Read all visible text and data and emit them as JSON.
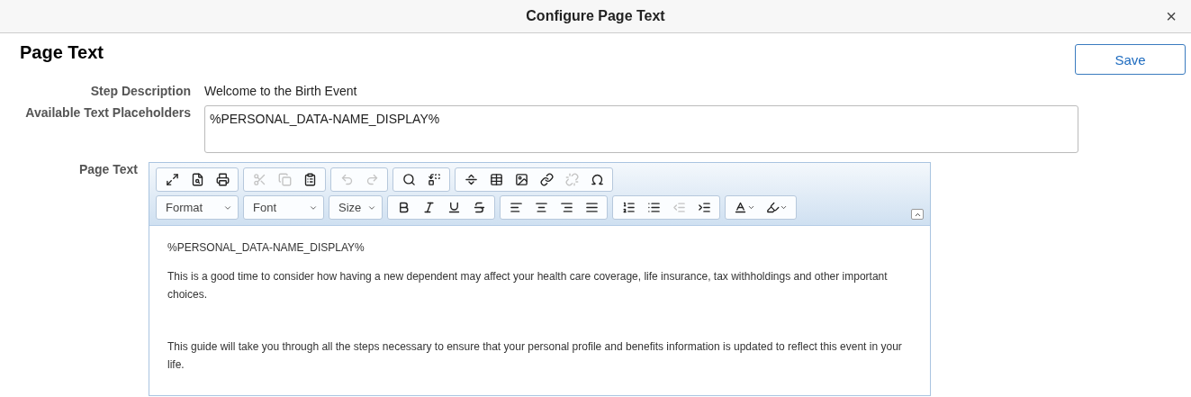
{
  "window": {
    "title": "Configure Page Text",
    "close": "×"
  },
  "page": {
    "heading": "Page Text",
    "save_button": "Save"
  },
  "fields": [
    {
      "kind": "text",
      "label": "Step Description",
      "value": "Welcome to the Birth Event"
    },
    {
      "kind": "textarea",
      "label": "Available Text Placeholders",
      "value": "%PERSONAL_DATA-NAME_DISPLAY%"
    }
  ],
  "editor": {
    "label": "Page Text",
    "toolbar_row_1": [
      [
        {
          "kind": "maximize",
          "disabled": false
        },
        {
          "kind": "preview",
          "disabled": false
        },
        {
          "kind": "print",
          "disabled": false
        }
      ],
      [
        {
          "kind": "cut",
          "disabled": true
        },
        {
          "kind": "copy",
          "disabled": true
        },
        {
          "kind": "paste",
          "disabled": false
        }
      ],
      [
        {
          "kind": "undo",
          "disabled": true
        },
        {
          "kind": "redo",
          "disabled": true
        }
      ],
      [
        {
          "kind": "find",
          "disabled": false
        },
        {
          "kind": "replace",
          "disabled": false
        }
      ],
      [
        {
          "kind": "rule",
          "disabled": false
        },
        {
          "kind": "table",
          "disabled": false
        },
        {
          "kind": "image",
          "disabled": false
        },
        {
          "kind": "link",
          "disabled": false
        },
        {
          "kind": "unlink",
          "disabled": true
        },
        {
          "kind": "symbol",
          "disabled": false
        }
      ]
    ],
    "dropdowns": [
      "Format",
      "Font",
      "Size"
    ],
    "toolbar_row_2": [
      [
        {
          "kind": "bold",
          "disabled": false
        },
        {
          "kind": "italic",
          "disabled": false
        },
        {
          "kind": "underline",
          "disabled": false
        },
        {
          "kind": "strike",
          "disabled": false
        }
      ],
      [
        {
          "kind": "align-left",
          "disabled": false
        },
        {
          "kind": "align-center",
          "disabled": false
        },
        {
          "kind": "align-right",
          "disabled": false
        },
        {
          "kind": "justify",
          "disabled": false
        }
      ],
      [
        {
          "kind": "numbered",
          "disabled": false
        },
        {
          "kind": "bulleted",
          "disabled": false
        },
        {
          "kind": "outdent",
          "disabled": true
        },
        {
          "kind": "indent",
          "disabled": false
        }
      ],
      [
        {
          "kind": "text-color",
          "disabled": false
        },
        {
          "kind": "bg-color",
          "disabled": false
        }
      ]
    ],
    "paragraphs": [
      {
        "text": "%PERSONAL_DATA-NAME_DISPLAY%",
        "space_before": false
      },
      {
        "text": "This is a good time to consider how having a new dependent may affect your health care coverage, life insurance, tax withholdings and other important choices.",
        "space_before": false
      },
      {
        "text": "This guide will take you through all the steps necessary to ensure that your personal profile and benefits information is updated to reflect this event in your life.",
        "space_before": true
      }
    ]
  }
}
